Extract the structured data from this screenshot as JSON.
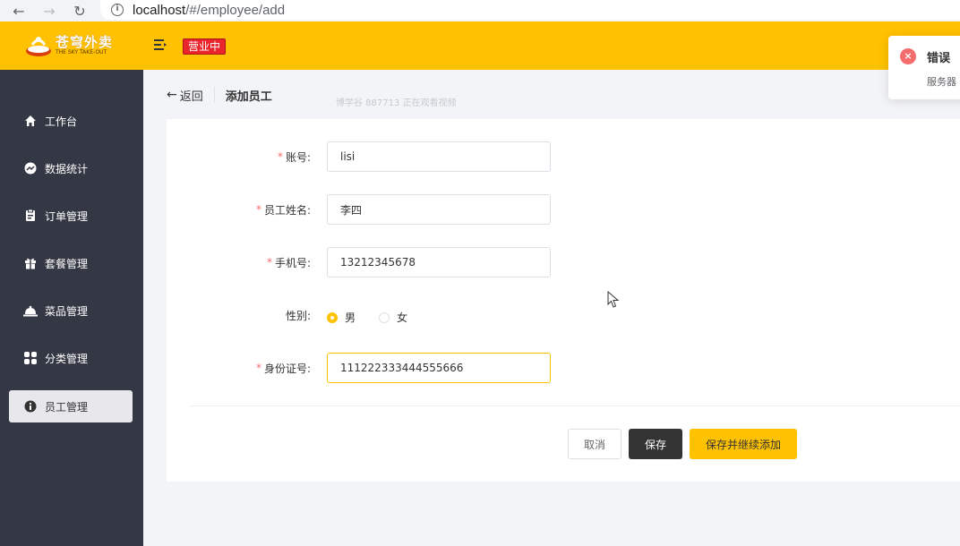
{
  "browser": {
    "url_host": "localhost",
    "url_path": "/#/employee/add"
  },
  "header": {
    "logo_cn": "苍穹外卖",
    "logo_en": "THE SKY TAKE-OUT",
    "status": "营业中",
    "accent_color": "#ffc100"
  },
  "sidebar": {
    "items": [
      {
        "label": "工作台",
        "icon": "home-icon"
      },
      {
        "label": "数据统计",
        "icon": "chart-icon"
      },
      {
        "label": "订单管理",
        "icon": "clipboard-icon"
      },
      {
        "label": "套餐管理",
        "icon": "gift-icon"
      },
      {
        "label": "菜品管理",
        "icon": "dish-icon"
      },
      {
        "label": "分类管理",
        "icon": "grid-icon"
      },
      {
        "label": "员工管理",
        "icon": "info-icon",
        "active": true
      }
    ]
  },
  "page": {
    "back_label": "返回",
    "title": "添加员工",
    "watermark": "博学谷 887713 正在观看视频"
  },
  "form": {
    "account_label": "账号:",
    "account_value": "lisi",
    "name_label": "员工姓名:",
    "name_value": "李四",
    "phone_label": "手机号:",
    "phone_value": "13212345678",
    "gender_label": "性别:",
    "gender_male": "男",
    "gender_female": "女",
    "gender_selected": "男",
    "idno_label": "身份证号:",
    "idno_value": "111222333444555666",
    "required_mark": "*"
  },
  "actions": {
    "cancel": "取消",
    "save": "保存",
    "save_and_add": "保存并继续添加"
  },
  "toast": {
    "title": "错误",
    "message": "服务器"
  }
}
